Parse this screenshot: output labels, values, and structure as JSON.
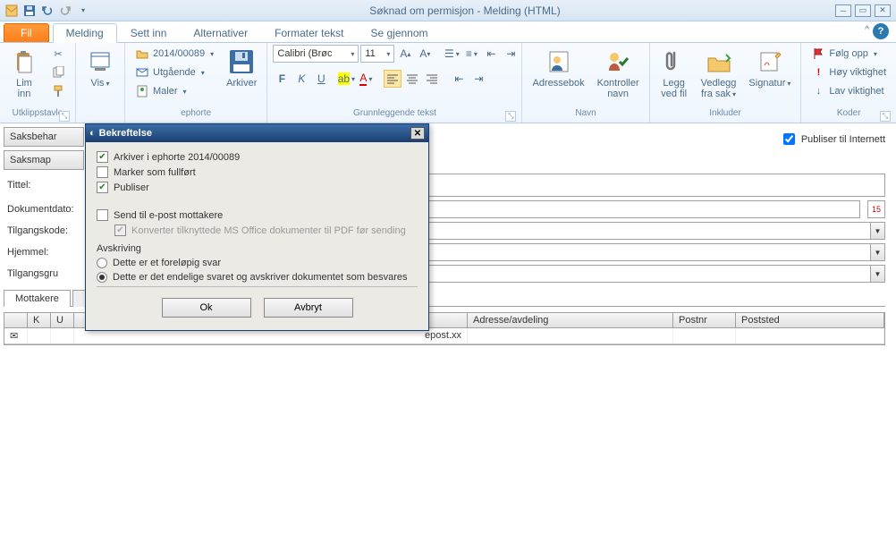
{
  "window": {
    "title": "Søknad om permisjon - Melding (HTML)"
  },
  "tabs": {
    "file": "Fil",
    "melding": "Melding",
    "settinn": "Sett inn",
    "alternativer": "Alternativer",
    "formater": "Formater tekst",
    "segjennom": "Se gjennom"
  },
  "ribbon": {
    "clipboard": {
      "paste": "Lim\ninn",
      "label": "Utklippstavle"
    },
    "view": {
      "btn": "Vis"
    },
    "ephorte": {
      "label": "ephorte",
      "case": "2014/00089",
      "utgaaende": "Utgående",
      "maler": "Maler",
      "arkiver": "Arkiver"
    },
    "font": {
      "label": "Grunnleggende tekst",
      "name": "Calibri (Brøc",
      "size": "11"
    },
    "names": {
      "label": "Navn",
      "addressbook": "Adressebok",
      "checknames": "Kontroller\nnavn"
    },
    "include": {
      "label": "Inkluder",
      "attach": "Legg\nved fil",
      "attachitem": "Vedlegg\nfra sak",
      "signature": "Signatur"
    },
    "tags": {
      "label": "Koder",
      "followup": "Følg opp",
      "high": "Høy viktighet",
      "low": "Lav viktighet"
    }
  },
  "form": {
    "saksbehandler": "Saksbehar",
    "saksmappe": "Saksmap",
    "tittel": "Tittel:",
    "dokumentdato": "Dokumentdato:",
    "dokumentdato_day": "15",
    "tilgangskode": "Tilgangskode:",
    "hjemmel": "Hjemmel:",
    "tilgangsgruppe": "Tilgangsgru",
    "publish": "Publiser til Internett"
  },
  "tabs2": {
    "mottakere": "Mottakere",
    "blank": ""
  },
  "grid": {
    "cols": {
      "k": "K",
      "u": "U",
      "navn": "",
      "adresse": "Adresse/avdeling",
      "postnr": "Postnr",
      "poststed": "Poststed"
    },
    "row1_fragment": "epost.xx"
  },
  "dialog": {
    "title": "Bekreftelse",
    "chk_arkiver": "Arkiver i ephorte 2014/00089",
    "chk_fullfort": "Marker som fullført",
    "chk_publiser": "Publiser",
    "chk_send": "Send til e-post mottakere",
    "chk_convert": "Konverter tilknyttede MS Office dokumenter til PDF før sending",
    "avskriving": "Avskriving",
    "radio_prelim": "Dette er et foreløpig svar",
    "radio_final": "Dette er det endelige svaret og avskriver dokumentet som besvares",
    "ok": "Ok",
    "cancel": "Avbryt"
  }
}
